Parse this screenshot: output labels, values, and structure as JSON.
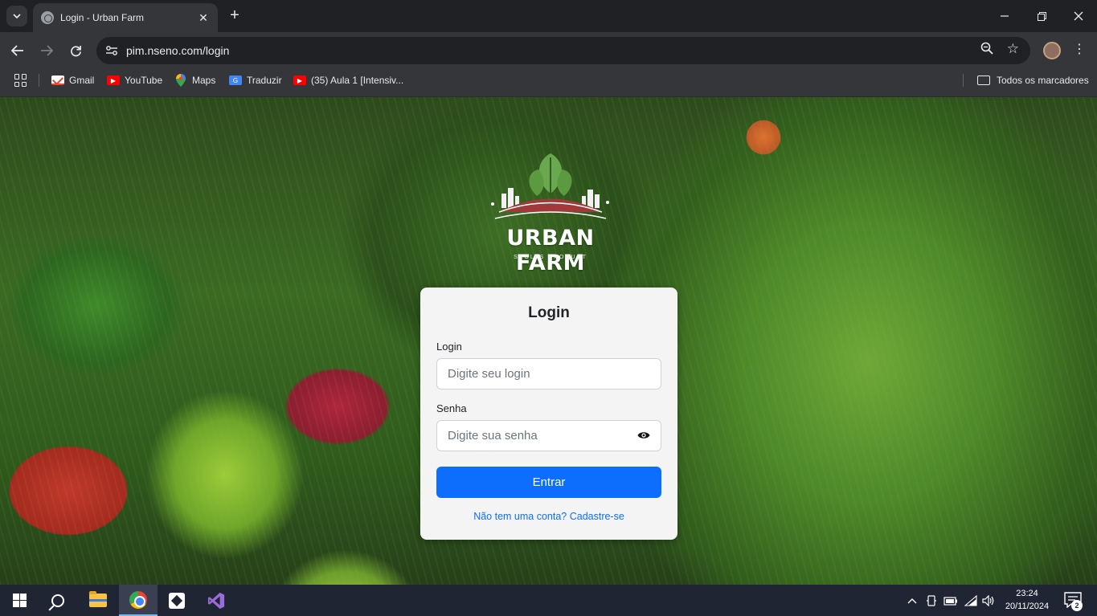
{
  "browser": {
    "tab_title": "Login - Urban Farm",
    "url": "pim.nseno.com/login",
    "bookmarks": [
      {
        "label": "Gmail",
        "icon": "gmail-icon"
      },
      {
        "label": "YouTube",
        "icon": "youtube-icon"
      },
      {
        "label": "Maps",
        "icon": "maps-icon"
      },
      {
        "label": "Traduzir",
        "icon": "translate-icon"
      },
      {
        "label": "(35) Aula 1 [Intensiv...",
        "icon": "youtube-icon"
      }
    ],
    "all_bookmarks_label": "Todos os marcadores"
  },
  "logo": {
    "title": "URBAN FARM",
    "subtitle": "SEOLLS PRODUCT"
  },
  "login_form": {
    "title": "Login",
    "login_label": "Login",
    "login_placeholder": "Digite seu login",
    "password_label": "Senha",
    "password_placeholder": "Digite sua senha",
    "submit_label": "Entrar",
    "signup_link": "Não tem uma conta? Cadastre-se"
  },
  "taskbar": {
    "time": "23:24",
    "date": "20/11/2024",
    "notification_count": "2"
  },
  "colors": {
    "primary": "#0d6efd",
    "browser_dark": "#202124",
    "browser_toolbar": "#35363a",
    "taskbar": "#1f2533"
  }
}
